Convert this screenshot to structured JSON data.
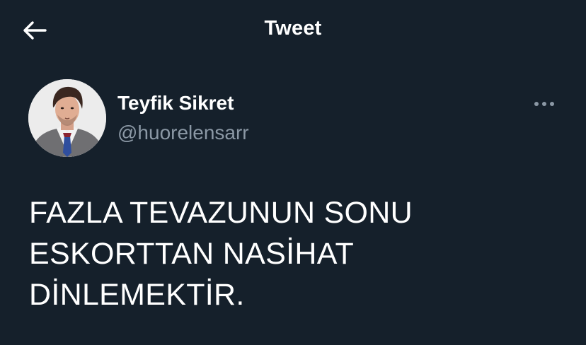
{
  "header": {
    "title": "Tweet",
    "back_icon": "arrow-left-icon"
  },
  "author": {
    "display_name": "Teyfik Sikret",
    "handle": "@huorelensarr",
    "avatar_icon": "profile-photo"
  },
  "more_icon": "more-horizontal-icon",
  "tweet": {
    "text": "FAZLA TEVAZUNUN SONU\nESKORTTAN NASİHAT\nDİNLEMEKTİR."
  },
  "colors": {
    "background": "#15202b",
    "text_primary": "#ffffff",
    "text_secondary": "#8b98a5"
  }
}
